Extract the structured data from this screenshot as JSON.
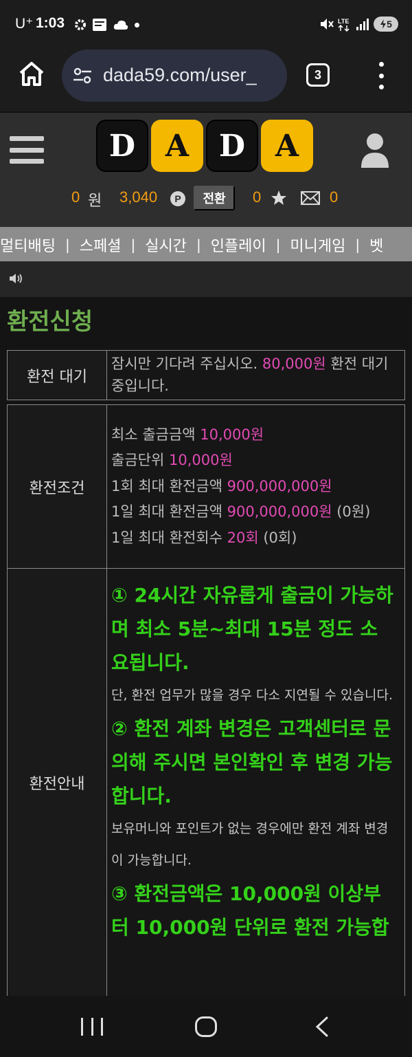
{
  "status_bar": {
    "carrier": "U⁺",
    "time": "1:03",
    "battery": "5"
  },
  "browser": {
    "url": "dada59.com/user_",
    "tab_count": "3"
  },
  "header": {
    "logo_letters": [
      "D",
      "A",
      "D",
      "A"
    ],
    "money_value": "0",
    "money_unit": "원",
    "point_value": "3,040",
    "point_badge": "P",
    "convert_label": "전환",
    "star_count": "0",
    "mail_count": "0"
  },
  "nav": {
    "items": [
      "멀티배팅",
      "스페셜",
      "실시간",
      "인플레이",
      "미니게임",
      "벳"
    ]
  },
  "page_title": "환전신청",
  "waiting": {
    "label": "환전 대기",
    "text_1": "잠시만 기다려 주십시오. ",
    "amount": "80,000원",
    "text_2": " 환전 대기중입니다."
  },
  "conditions": {
    "label": "환전조건",
    "rows": [
      {
        "label": "최소 출금금액 ",
        "value": "10,000원",
        "suffix": ""
      },
      {
        "label": "출금단위 ",
        "value": "10,000원",
        "suffix": ""
      },
      {
        "label": "1회 최대 환전금액 ",
        "value": "900,000,000원",
        "suffix": ""
      },
      {
        "label": "1일 최대 환전금액 ",
        "value": "900,000,000원",
        "suffix": " (0원)"
      },
      {
        "label": "1일 최대 환전회수 ",
        "value": "20회",
        "suffix": " (0회)"
      }
    ]
  },
  "guide": {
    "label": "환전안내",
    "item1_title": "① 24시간 자유롭게 출금이 가능하며 최소 5분~최대 15분 정도 소요됩니다.",
    "item1_note": "단, 환전 업무가 많을 경우 다소 지연될 수 있습니다.",
    "item2_title": "② 환전 계좌 변경은 고객센터로 문의해 주시면 본인확인 후 변경 가능합니다.",
    "item2_note": "보유머니와 포인트가 없는 경우에만 환전 계좌 변경이 가능합니다.",
    "item3_title": "③ 환전금액은 10,000원 이상부터 10,000원 단위로 환전 가능합"
  },
  "colors": {
    "accent_orange": "#f39c12",
    "logo_gold": "#f5b800",
    "highlight_pink": "#e14bb4",
    "guide_green": "#34d11a",
    "title_green": "#6fae4f"
  },
  "icons": {
    "status_left": [
      "gear-icon",
      "news-app-icon",
      "cloud-icon"
    ],
    "status_right": [
      "mute-icon",
      "lte-icon",
      "signal-icon",
      "battery-icon"
    ],
    "browser": [
      "home-icon",
      "site-settings-icon",
      "tabs-icon",
      "more-icon"
    ],
    "header": [
      "hamburger-icon",
      "user-icon",
      "star-icon",
      "mail-icon"
    ],
    "notice": "speaker-icon"
  }
}
